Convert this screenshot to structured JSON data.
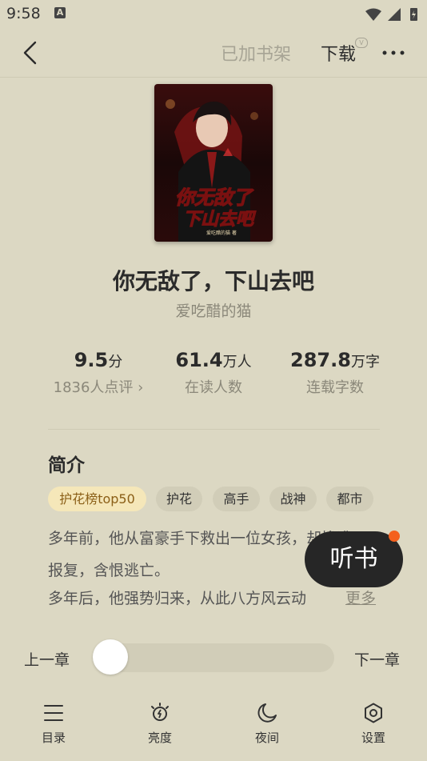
{
  "status_bar": {
    "time": "9:58",
    "notification_icon": "A"
  },
  "header": {
    "shelf_label": "已加书架",
    "download_label": "下载",
    "download_badge": "V"
  },
  "book": {
    "title": "你无敌了，下山去吧",
    "author": "爱吃醋的猫",
    "cover_title_line1": "你无敌了",
    "cover_title_line2": "下山去吧",
    "cover_author": "爱吃醋的猫 著"
  },
  "stats": [
    {
      "value": "9.5",
      "unit": "分",
      "label": "1836人点评 ›"
    },
    {
      "value": "61.4",
      "unit": "万人",
      "label": "在读人数"
    },
    {
      "value": "287.8",
      "unit": "万字",
      "label": "连载字数"
    }
  ],
  "intro": {
    "heading": "简介",
    "tags": [
      "护花榜top50",
      "护花",
      "高手",
      "战神",
      "都市"
    ],
    "lines": [
      "多年前，他从富豪手下救出一位女孩，却惨遭",
      "报复，含恨逃亡。",
      "多年后，他强势归来，从此八方风云动"
    ],
    "more_label": "更多"
  },
  "listen_label": "听书",
  "chapter_nav": {
    "prev_label": "上一章",
    "next_label": "下一章",
    "progress": 0.0
  },
  "bottom_nav": [
    {
      "label": "目录",
      "icon": "list-icon"
    },
    {
      "label": "亮度",
      "icon": "brightness-icon"
    },
    {
      "label": "夜间",
      "icon": "moon-icon"
    },
    {
      "label": "设置",
      "icon": "settings-icon"
    }
  ]
}
